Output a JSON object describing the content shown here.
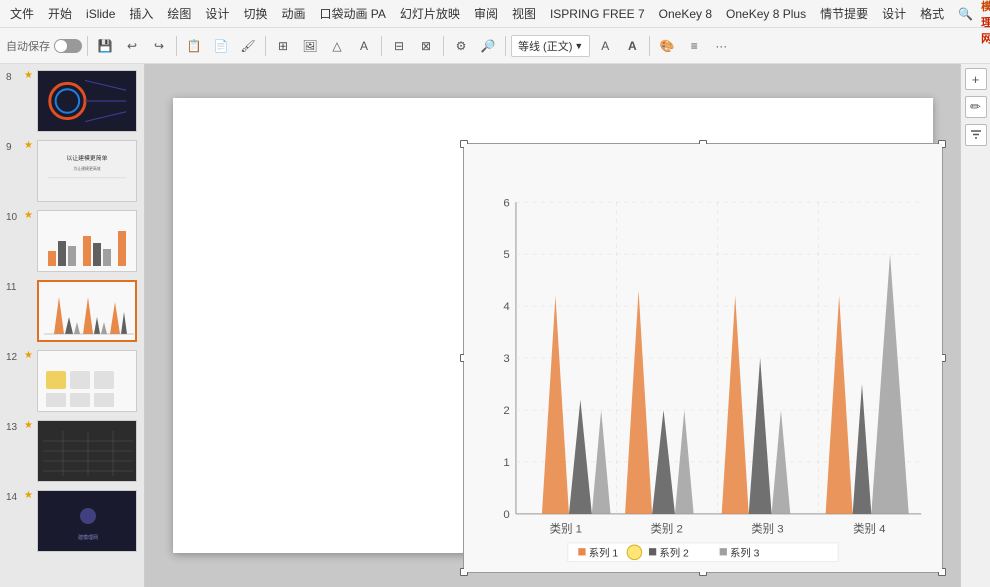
{
  "menubar": {
    "items": [
      "文件",
      "开始",
      "iSlide",
      "插入",
      "绘图",
      "设计",
      "切换",
      "动画",
      "口袋动画 PA",
      "幻灯片放映",
      "审阅",
      "视图",
      "ISPRING FREE 7",
      "OneKey 8",
      "OneKey 8 Plus",
      "情节提要",
      "设计",
      "格式"
    ]
  },
  "toolbar": {
    "autosave_label": "自动保存",
    "dropdown_label": "等线 (正文)",
    "icons": [
      "save",
      "undo",
      "redo",
      "copy",
      "paste",
      "format"
    ]
  },
  "slides": [
    {
      "num": "8",
      "star": "★",
      "type": "dark-circle"
    },
    {
      "num": "9",
      "star": "★",
      "type": "light-text"
    },
    {
      "num": "10",
      "star": "★",
      "type": "bar-chart"
    },
    {
      "num": "11",
      "star": "",
      "type": "line-chart",
      "active": true
    },
    {
      "num": "12",
      "star": "★",
      "type": "yellow-chart"
    },
    {
      "num": "13",
      "star": "★",
      "type": "dark-table"
    },
    {
      "num": "14",
      "star": "★",
      "type": "dark-bg"
    }
  ],
  "chart": {
    "title": "",
    "y_max": 6,
    "y_labels": [
      "0",
      "1",
      "2",
      "3",
      "4",
      "5",
      "6"
    ],
    "x_labels": [
      "类别 1",
      "类别 2",
      "类别 3",
      "类别 4"
    ],
    "series": [
      {
        "name": "系列 1",
        "color": "#e8894a",
        "values": [
          4.2,
          4.3,
          4.2,
          4.2
        ]
      },
      {
        "name": "系列 2",
        "color": "#606060",
        "values": [
          2.2,
          2.0,
          3.0,
          2.5
        ]
      },
      {
        "name": "系列 3",
        "color": "#a0a0a0",
        "values": [
          2.0,
          2.0,
          2.0,
          5.0
        ]
      }
    ],
    "legend": {
      "series1": "系列 1",
      "series2": "系列 2",
      "series3": "系列 3"
    }
  },
  "right_panel": {
    "add_label": "+",
    "pencil_label": "✏",
    "filter_label": "▼"
  },
  "logo": {
    "text": "建模理网"
  }
}
